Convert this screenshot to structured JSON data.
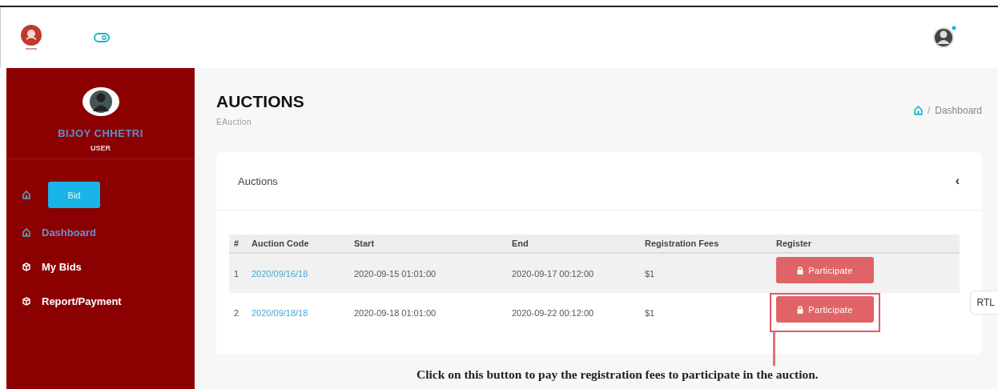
{
  "user": {
    "name": "BIJOY CHHETRI",
    "role": "USER"
  },
  "bid_button": "Bid",
  "sidebar": {
    "items": [
      {
        "label": "Dashboard",
        "selected": true
      },
      {
        "label": "My Bids",
        "selected": false
      },
      {
        "label": "Report/Payment",
        "selected": false
      }
    ]
  },
  "page": {
    "title": "AUCTIONS",
    "subtitle": "EAuction",
    "breadcrumb": {
      "separator": "/",
      "current": "Dashboard"
    }
  },
  "card": {
    "title": "Auctions",
    "collapse": "‹"
  },
  "table": {
    "columns": [
      "#",
      "Auction Code",
      "Start",
      "End",
      "Registration Fees",
      "Register"
    ],
    "rows": [
      {
        "num": "1",
        "code": "2020/09/16/18",
        "start": "2020-09-15 01:01:00",
        "end": "2020-09-17 00:12:00",
        "fee": "$1",
        "action": "Participate",
        "highlighted": true,
        "callout": false
      },
      {
        "num": "2",
        "code": "2020/09/18/18",
        "start": "2020-09-18 01:01:00",
        "end": "2020-09-22 00:12:00",
        "fee": "$1",
        "action": "Participate",
        "highlighted": false,
        "callout": true
      }
    ]
  },
  "rtl_tab": "RTL",
  "callout_text": "Click on this button to pay the registration fees to participate in the auction."
}
